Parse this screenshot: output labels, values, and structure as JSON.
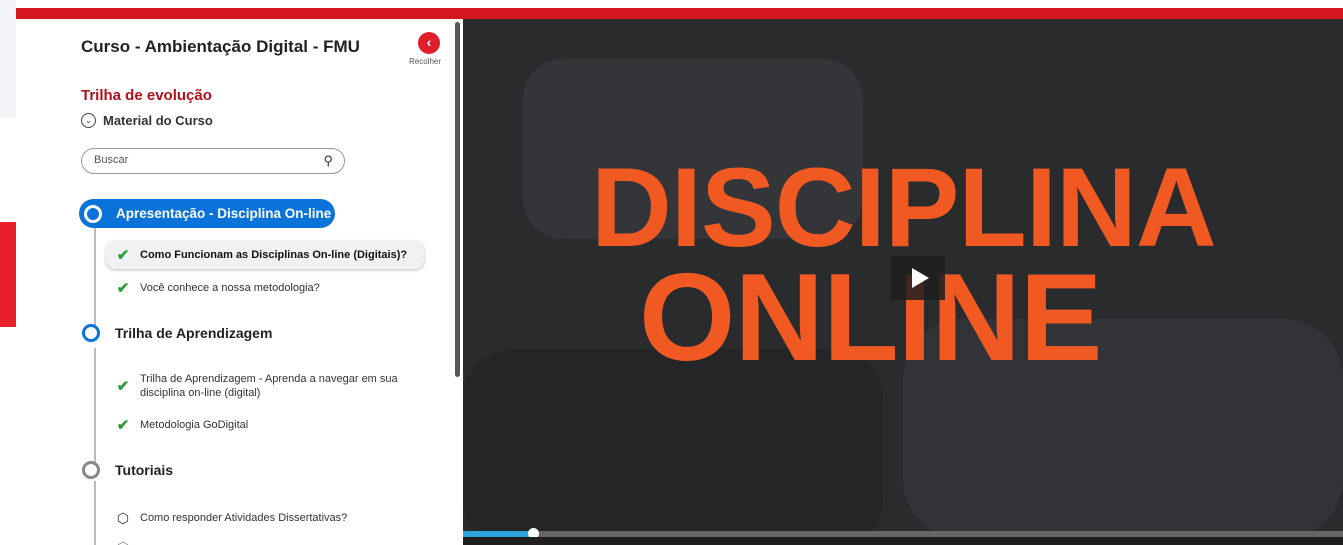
{
  "course": {
    "title": "Curso - Ambientação Digital - FMU",
    "collapse_label": "Recolher"
  },
  "trail": {
    "title": "Trilha de evolução",
    "material_label": "Material do Curso"
  },
  "search": {
    "placeholder": "Buscar"
  },
  "sections": [
    {
      "label": "Apresentação - Disciplina On-line",
      "status": "active",
      "items": [
        {
          "label": "Como Funcionam as Disciplinas On-line (Digitais)?",
          "icon": "check-icon",
          "active": true
        },
        {
          "label": "Você conhece a nossa metodologia?",
          "icon": "check-icon",
          "active": false
        }
      ]
    },
    {
      "label": "Trilha de Aprendizagem",
      "status": "in-progress",
      "items": [
        {
          "label": "Trilha de Aprendizagem - Aprenda a navegar em sua disciplina on-line (digital)",
          "icon": "check-icon",
          "active": false
        },
        {
          "label": "Metodologia GoDigital",
          "icon": "check-icon",
          "active": false
        }
      ]
    },
    {
      "label": "Tutoriais",
      "status": "not-started",
      "items": [
        {
          "label": "Como responder Atividades Dissertativas?",
          "icon": "cube-icon",
          "active": false
        }
      ]
    }
  ],
  "video": {
    "title_line1": "DISCIPLINA",
    "title_line2": "ONLINE",
    "progress": 0.08
  },
  "colors": {
    "brand_red": "#d4171e",
    "accent_blue": "#0a73d9",
    "check_green": "#2e9d3a",
    "video_orange": "#f05a22"
  }
}
